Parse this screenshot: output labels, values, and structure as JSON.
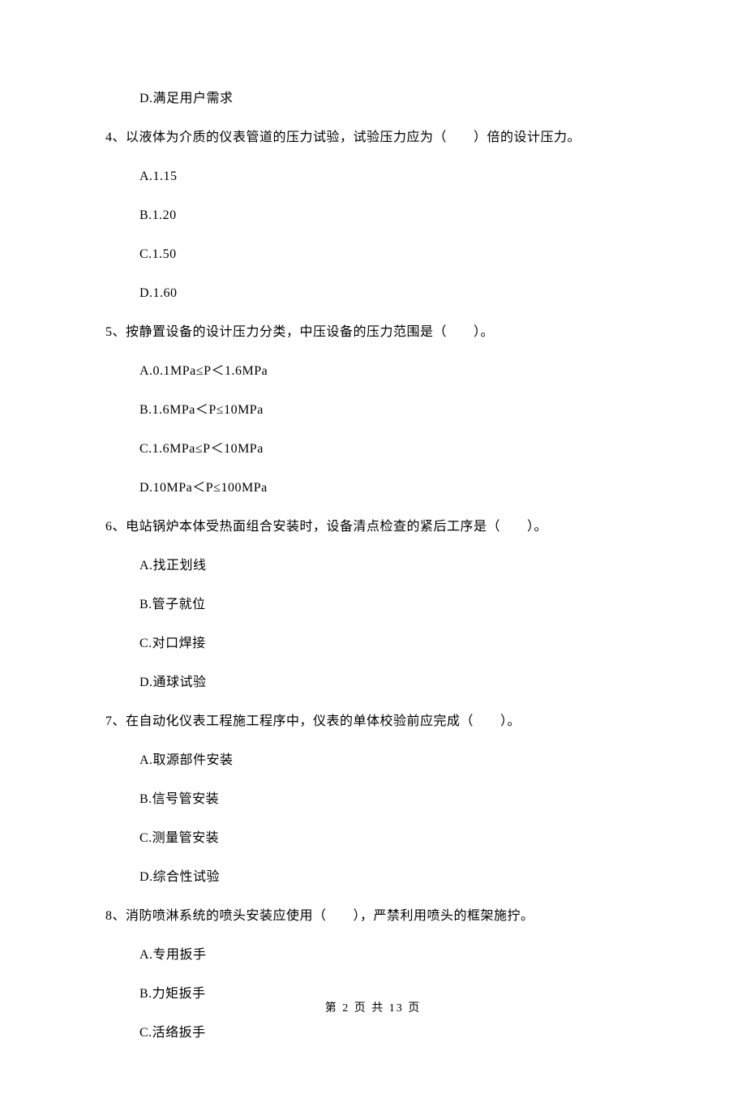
{
  "q3": {
    "options": {
      "D": "D.满足用户需求"
    }
  },
  "q4": {
    "stem": "4、以液体为介质的仪表管道的压力试验，试验压力应为（　　）倍的设计压力。",
    "options": {
      "A": "A.1.15",
      "B": "B.1.20",
      "C": "C.1.50",
      "D": "D.1.60"
    }
  },
  "q5": {
    "stem": "5、按静置设备的设计压力分类，中压设备的压力范围是（　　）。",
    "options": {
      "A": "A.0.1MPa≤P＜1.6MPa",
      "B": "B.1.6MPa＜P≤10MPa",
      "C": "C.1.6MPa≤P＜10MPa",
      "D": "D.10MPa＜P≤100MPa"
    }
  },
  "q6": {
    "stem": "6、电站锅炉本体受热面组合安装时，设备清点检查的紧后工序是（　　）。",
    "options": {
      "A": "A.找正划线",
      "B": "B.管子就位",
      "C": "C.对口焊接",
      "D": "D.通球试验"
    }
  },
  "q7": {
    "stem": "7、在自动化仪表工程施工程序中，仪表的单体校验前应完成（　　）。",
    "options": {
      "A": "A.取源部件安装",
      "B": "B.信号管安装",
      "C": "C.测量管安装",
      "D": "D.综合性试验"
    }
  },
  "q8": {
    "stem": "8、消防喷淋系统的喷头安装应使用（　　），严禁利用喷头的框架施拧。",
    "options": {
      "A": "A.专用扳手",
      "B": "B.力矩扳手",
      "C": "C.活络扳手"
    }
  },
  "footer": "第 2 页 共 13 页"
}
